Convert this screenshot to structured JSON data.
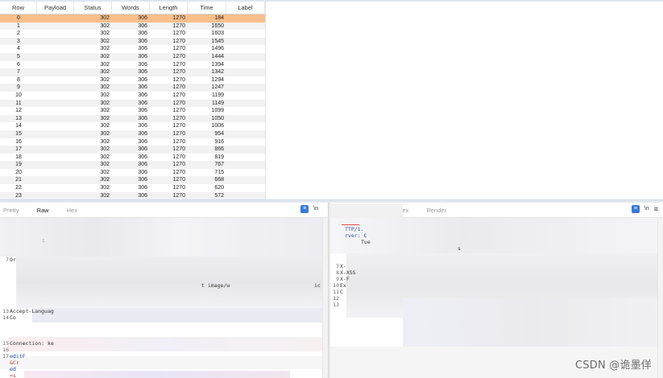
{
  "results": {
    "columns": [
      "Row",
      "Payload",
      "Status",
      "Words",
      "Length",
      "Time",
      "Label"
    ],
    "selected_row": 0,
    "rows": [
      {
        "row": "0",
        "payload": "",
        "status": "302",
        "words": "306",
        "length": "1270",
        "time": "184"
      },
      {
        "row": "1",
        "payload": "",
        "status": "302",
        "words": "306",
        "length": "1270",
        "time": "1650"
      },
      {
        "row": "2",
        "payload": "",
        "status": "302",
        "words": "306",
        "length": "1270",
        "time": "1603"
      },
      {
        "row": "3",
        "payload": "",
        "status": "302",
        "words": "306",
        "length": "1270",
        "time": "1545"
      },
      {
        "row": "4",
        "payload": "",
        "status": "302",
        "words": "306",
        "length": "1270",
        "time": "1496"
      },
      {
        "row": "5",
        "payload": "",
        "status": "302",
        "words": "306",
        "length": "1270",
        "time": "1444"
      },
      {
        "row": "6",
        "payload": "",
        "status": "302",
        "words": "306",
        "length": "1270",
        "time": "1394"
      },
      {
        "row": "7",
        "payload": "",
        "status": "302",
        "words": "306",
        "length": "1270",
        "time": "1342"
      },
      {
        "row": "8",
        "payload": "",
        "status": "302",
        "words": "306",
        "length": "1270",
        "time": "1294"
      },
      {
        "row": "9",
        "payload": "",
        "status": "302",
        "words": "306",
        "length": "1270",
        "time": "1247"
      },
      {
        "row": "10",
        "payload": "",
        "status": "302",
        "words": "306",
        "length": "1270",
        "time": "1199"
      },
      {
        "row": "11",
        "payload": "",
        "status": "302",
        "words": "306",
        "length": "1270",
        "time": "1149"
      },
      {
        "row": "12",
        "payload": "",
        "status": "302",
        "words": "306",
        "length": "1270",
        "time": "1099"
      },
      {
        "row": "13",
        "payload": "",
        "status": "302",
        "words": "306",
        "length": "1270",
        "time": "1050"
      },
      {
        "row": "14",
        "payload": "",
        "status": "302",
        "words": "306",
        "length": "1270",
        "time": "1006"
      },
      {
        "row": "15",
        "payload": "",
        "status": "302",
        "words": "306",
        "length": "1270",
        "time": "954"
      },
      {
        "row": "16",
        "payload": "",
        "status": "302",
        "words": "306",
        "length": "1270",
        "time": "916"
      },
      {
        "row": "17",
        "payload": "",
        "status": "302",
        "words": "306",
        "length": "1270",
        "time": "866"
      },
      {
        "row": "18",
        "payload": "",
        "status": "302",
        "words": "306",
        "length": "1270",
        "time": "819"
      },
      {
        "row": "19",
        "payload": "",
        "status": "302",
        "words": "306",
        "length": "1270",
        "time": "767"
      },
      {
        "row": "20",
        "payload": "",
        "status": "302",
        "words": "306",
        "length": "1270",
        "time": "715"
      },
      {
        "row": "21",
        "payload": "",
        "status": "302",
        "words": "306",
        "length": "1270",
        "time": "668"
      },
      {
        "row": "22",
        "payload": "",
        "status": "302",
        "words": "306",
        "length": "1270",
        "time": "620"
      },
      {
        "row": "23",
        "payload": "",
        "status": "302",
        "words": "306",
        "length": "1270",
        "time": "572"
      }
    ]
  },
  "request_editor": {
    "tabs": [
      {
        "label": "Pretty",
        "active": false
      },
      {
        "label": "Raw",
        "active": true
      },
      {
        "label": "Hex",
        "active": false
      }
    ],
    "wrap_icon": "wrap-lines-icon",
    "newline_icon": "\\n",
    "lines": [
      {
        "num": "7",
        "text": "Or"
      },
      {
        "num": "13",
        "text": "Accept-Languag"
      },
      {
        "num": "14",
        "text": "Co"
      },
      {
        "num": "15",
        "text": "Connection: ke"
      },
      {
        "num": "16",
        "text": ""
      },
      {
        "num": "17",
        "text": "editF"
      },
      {
        "text": "&Cr"
      },
      {
        "text": "ed"
      },
      {
        "text": "=s"
      }
    ],
    "fragments": [
      "t image/w",
      "ic"
    ]
  },
  "response_editor": {
    "tabs": [
      {
        "label": "Hex",
        "active": false
      },
      {
        "label": "Render",
        "active": false
      }
    ],
    "wrap_icon": "wrap-lines-icon",
    "newline_icon": "\\n",
    "menu_icon": "menu-icon",
    "lines": [
      {
        "num": "",
        "text": "TTP/1."
      },
      {
        "num": "",
        "text": "rver: C"
      },
      {
        "num": "",
        "text": "Tue"
      },
      {
        "num": "7",
        "text": "X-"
      },
      {
        "num": "8",
        "text": "X-XSS"
      },
      {
        "num": "9",
        "text": "X-F"
      },
      {
        "num": "10",
        "text": "Ex"
      },
      {
        "num": "11",
        "text": "C"
      },
      {
        "num": "12",
        "text": ""
      },
      {
        "num": "13",
        "text": ""
      }
    ]
  },
  "watermark": "CSDN @诡墨佯"
}
